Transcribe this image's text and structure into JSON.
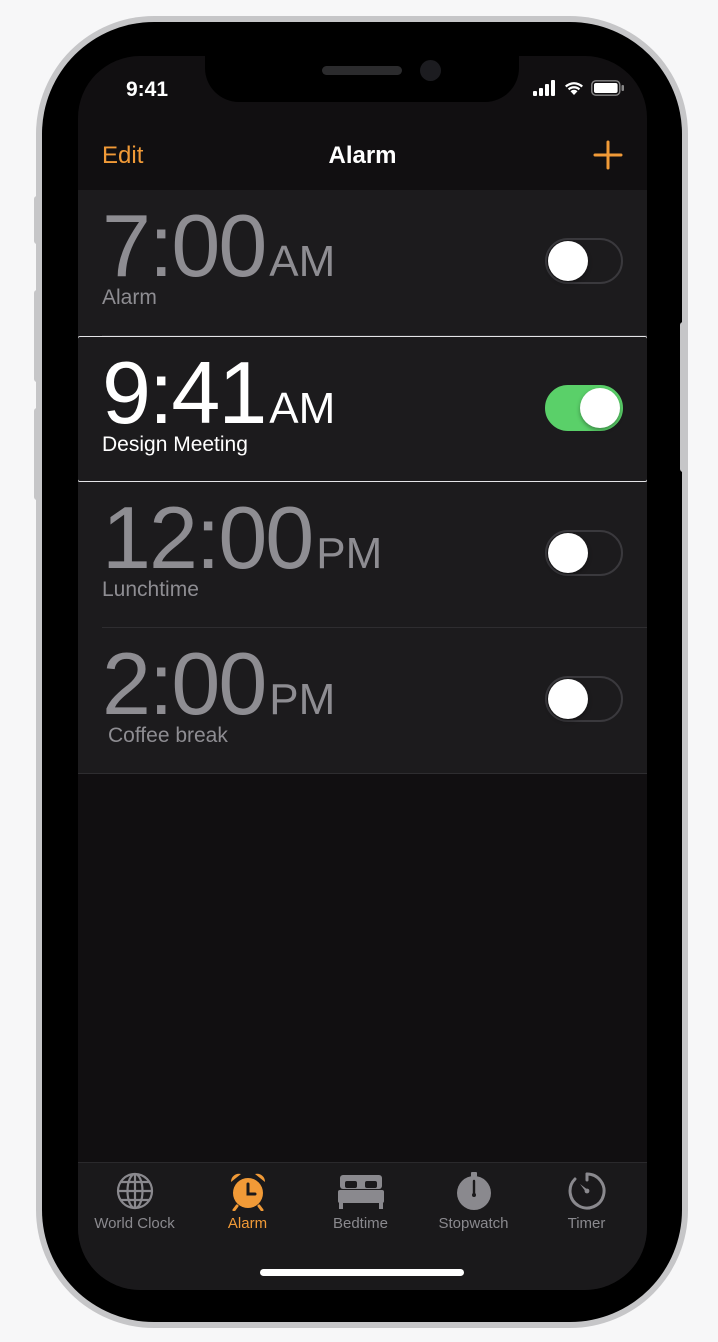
{
  "status_bar": {
    "time": "9:41"
  },
  "nav": {
    "edit_label": "Edit",
    "title": "Alarm"
  },
  "alarms": [
    {
      "time": "7:00",
      "ampm": "AM",
      "label": "Alarm",
      "enabled": false
    },
    {
      "time": "9:41",
      "ampm": "AM",
      "label": "Design Meeting",
      "enabled": true
    },
    {
      "time": "12:00",
      "ampm": "PM",
      "label": "Lunchtime",
      "enabled": false
    },
    {
      "time": "2:00",
      "ampm": "PM",
      "label": "Coffee break",
      "enabled": false
    }
  ],
  "tabs": [
    {
      "label": "World Clock",
      "icon": "globe-icon",
      "active": false
    },
    {
      "label": "Alarm",
      "icon": "alarm-clock-icon",
      "active": true
    },
    {
      "label": "Bedtime",
      "icon": "bed-icon",
      "active": false
    },
    {
      "label": "Stopwatch",
      "icon": "stopwatch-icon",
      "active": false
    },
    {
      "label": "Timer",
      "icon": "timer-icon",
      "active": false
    }
  ],
  "colors": {
    "accent": "#f19a37",
    "toggle_on": "#5ad069",
    "background": "#110f11",
    "row_background": "#1c1b1d",
    "inactive_text": "#8e8d92"
  }
}
